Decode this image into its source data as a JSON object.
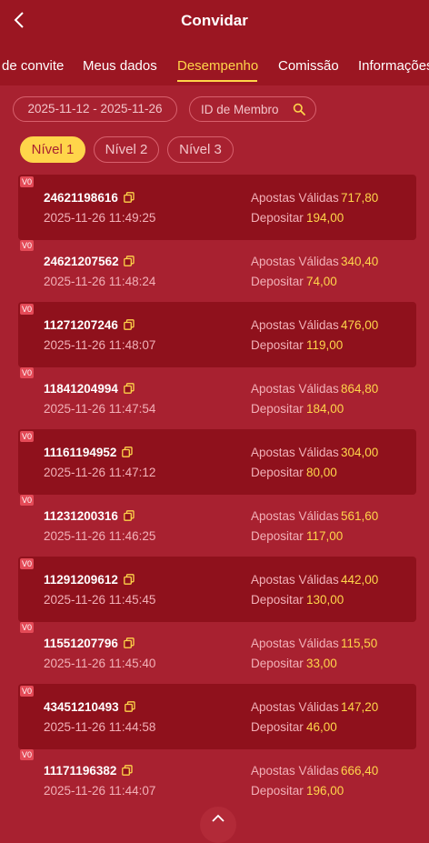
{
  "header": {
    "title": "Convidar"
  },
  "tabs": [
    {
      "label": "de convite"
    },
    {
      "label": "Meus dados"
    },
    {
      "label": "Desempenho"
    },
    {
      "label": "Comissão"
    },
    {
      "label": "Informações"
    }
  ],
  "active_tab": "Desempenho",
  "filters": {
    "date_range": "2025-11-12 - 2025-11-26",
    "member_placeholder": "ID de Membro"
  },
  "levels": [
    {
      "label": "Nível 1"
    },
    {
      "label": "Nível 2"
    },
    {
      "label": "Nível 3"
    }
  ],
  "active_level": "Nível 1",
  "labels": {
    "bets": "Apostas Válidas",
    "deposit": "Depositar"
  },
  "records": [
    {
      "badge": "V0",
      "id": "24621198616",
      "datetime": "2025-11-26 11:49:25",
      "bets": "717,80",
      "deposit": "194,00"
    },
    {
      "badge": "V0",
      "id": "24621207562",
      "datetime": "2025-11-26 11:48:24",
      "bets": "340,40",
      "deposit": "74,00"
    },
    {
      "badge": "V0",
      "id": "11271207246",
      "datetime": "2025-11-26 11:48:07",
      "bets": "476,00",
      "deposit": "119,00"
    },
    {
      "badge": "V0",
      "id": "11841204994",
      "datetime": "2025-11-26 11:47:54",
      "bets": "864,80",
      "deposit": "184,00"
    },
    {
      "badge": "V0",
      "id": "11161194952",
      "datetime": "2025-11-26 11:47:12",
      "bets": "304,00",
      "deposit": "80,00"
    },
    {
      "badge": "V0",
      "id": "11231200316",
      "datetime": "2025-11-26 11:46:25",
      "bets": "561,60",
      "deposit": "117,00"
    },
    {
      "badge": "V0",
      "id": "11291209612",
      "datetime": "2025-11-26 11:45:45",
      "bets": "442,00",
      "deposit": "130,00"
    },
    {
      "badge": "V0",
      "id": "11551207796",
      "datetime": "2025-11-26 11:45:40",
      "bets": "115,50",
      "deposit": "33,00"
    },
    {
      "badge": "V0",
      "id": "43451210493",
      "datetime": "2025-11-26 11:44:58",
      "bets": "147,20",
      "deposit": "46,00"
    },
    {
      "badge": "V0",
      "id": "11171196382",
      "datetime": "2025-11-26 11:44:07",
      "bets": "666,40",
      "deposit": "196,00"
    }
  ],
  "icons": {
    "back": "chevron-left-icon",
    "search": "search-icon",
    "copy": "copy-icon",
    "scroll_top": "chevron-up-icon"
  },
  "colors": {
    "background": "#a82130",
    "header": "#9b1622",
    "card": "#8f111c",
    "accent": "#ffd54a",
    "badge": "#e44a57"
  }
}
